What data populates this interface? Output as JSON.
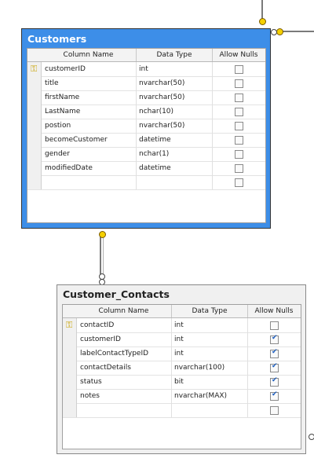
{
  "tables": {
    "customers": {
      "title": "Customers",
      "headers": {
        "column_name": "Column Name",
        "data_type": "Data Type",
        "allow_nulls": "Allow Nulls"
      },
      "rows": [
        {
          "name": "customerID",
          "type": "int",
          "allow_nulls": false,
          "primary_key": true
        },
        {
          "name": "title",
          "type": "nvarchar(50)",
          "allow_nulls": false
        },
        {
          "name": "firstName",
          "type": "nvarchar(50)",
          "allow_nulls": false
        },
        {
          "name": "LastName",
          "type": "nchar(10)",
          "allow_nulls": false
        },
        {
          "name": "postion",
          "type": "nvarchar(50)",
          "allow_nulls": false
        },
        {
          "name": "becomeCustomer",
          "type": "datetime",
          "allow_nulls": false
        },
        {
          "name": "gender",
          "type": "nchar(1)",
          "allow_nulls": false
        },
        {
          "name": "modifiedDate",
          "type": "datetime",
          "allow_nulls": false
        },
        {
          "name": "",
          "type": "",
          "allow_nulls": false
        }
      ]
    },
    "customer_contacts": {
      "title": "Customer_Contacts",
      "headers": {
        "column_name": "Column Name",
        "data_type": "Data Type",
        "allow_nulls": "Allow Nulls"
      },
      "rows": [
        {
          "name": "contactID",
          "type": "int",
          "allow_nulls": false,
          "primary_key": true
        },
        {
          "name": "customerID",
          "type": "int",
          "allow_nulls": true
        },
        {
          "name": "labelContactTypeID",
          "type": "int",
          "allow_nulls": true
        },
        {
          "name": "contactDetails",
          "type": "nvarchar(100)",
          "allow_nulls": true
        },
        {
          "name": "status",
          "type": "bit",
          "allow_nulls": true
        },
        {
          "name": "notes",
          "type": "nvarchar(MAX)",
          "allow_nulls": true
        },
        {
          "name": "",
          "type": "",
          "allow_nulls": false
        }
      ]
    }
  },
  "colors": {
    "selected_table": "#3d8ee8",
    "key_icon": "#c9a200",
    "check": "#1f5fbf"
  }
}
